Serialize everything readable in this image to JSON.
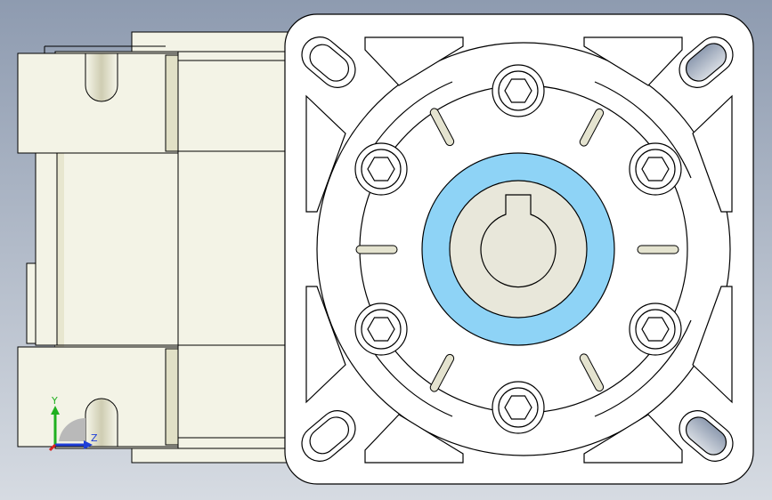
{
  "viewport": {
    "background_top": "#8e9bb0",
    "background_bottom": "#d6dbe2"
  },
  "part": {
    "body_color": "#f3f3e6",
    "shadow_color": "#d9d8bf",
    "edge_color": "#000000",
    "flange_color": "#ffffff",
    "bore_color": "#e8e7da",
    "seal_ring_color": "#8ed3f6"
  },
  "triad": {
    "y_label": "Y",
    "z_label": "Z",
    "y_color": "#1fb01f",
    "z_color": "#1f3fd8",
    "x_color": "#d81f1f"
  }
}
